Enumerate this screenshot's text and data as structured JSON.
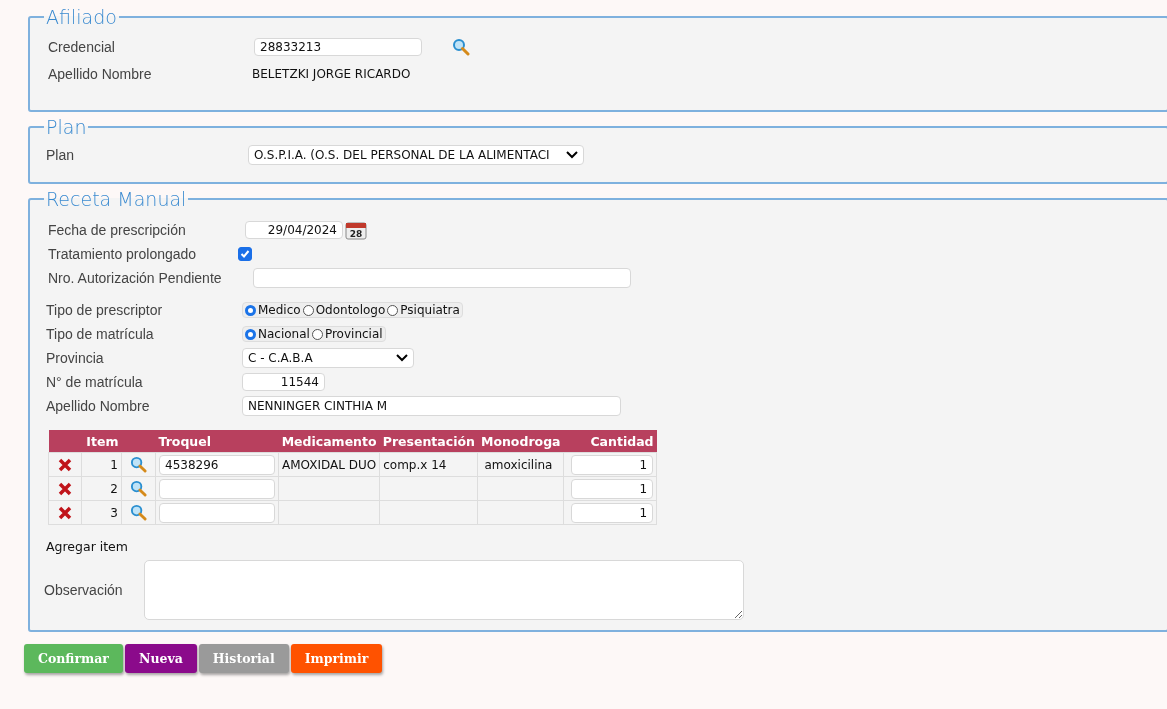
{
  "afiliado": {
    "legend": "Afiliado",
    "credencial_label": "Credencial",
    "credencial_value": "28833213",
    "nombre_label": "Apellido Nombre",
    "nombre_value": "BELETZKI JORGE RICARDO"
  },
  "plan": {
    "legend": "Plan",
    "label": "Plan",
    "value": "O.S.P.I.A. (O.S. DEL PERSONAL DE LA ALIMENTACI"
  },
  "receta": {
    "legend": "Receta Manual",
    "fecha_label": "Fecha de prescripción",
    "fecha_value": "29/04/2024",
    "calendar_day": "28",
    "tratamiento_label": "Tratamiento prolongado",
    "tratamiento_checked": true,
    "autorizacion_label": "Nro. Autorización Pendiente",
    "prescriptor_label": "Tipo de prescriptor",
    "prescriptor_options": [
      {
        "label": "Medico",
        "selected": true
      },
      {
        "label": "Odontologo",
        "selected": false
      },
      {
        "label": "Psiquiatra",
        "selected": false
      }
    ],
    "matricula_tipo_label": "Tipo de matrícula",
    "matricula_tipo_options": [
      {
        "label": "Nacional",
        "selected": true
      },
      {
        "label": "Provincial",
        "selected": false
      }
    ],
    "provincia_label": "Provincia",
    "provincia_value": "C - C.A.B.A",
    "matricula_label": "N° de matrícula",
    "matricula_value": "11544",
    "nombre_label": "Apellido Nombre",
    "nombre_value": "NENNINGER CINTHIA M",
    "table": {
      "columns": [
        "Item",
        "Troquel",
        "Medicamento",
        "Presentación",
        "Monodroga",
        "Cantidad"
      ],
      "rows": [
        {
          "item": "1",
          "troquel": "4538296",
          "medicamento": "AMOXIDAL DUO",
          "presentacion": "comp.x 14",
          "monodroga": "amoxicilina",
          "cantidad": "1"
        },
        {
          "item": "2",
          "cantidad": "1"
        },
        {
          "item": "3",
          "cantidad": "1"
        }
      ]
    },
    "agregar": "Agregar item",
    "observacion_label": "Observación"
  },
  "buttons": [
    {
      "label": "Confirmar",
      "color": "#5cb85c"
    },
    {
      "label": "Nueva",
      "color": "#8b0a8b"
    },
    {
      "label": "Historial",
      "color": "#9a9a9a"
    },
    {
      "label": "Imprimir",
      "color": "#ff5200"
    }
  ]
}
